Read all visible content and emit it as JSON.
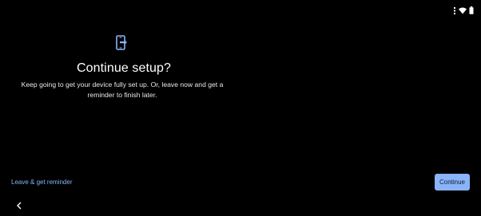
{
  "status_bar": {
    "icons": [
      "signal-icon",
      "wifi-icon",
      "battery-icon"
    ]
  },
  "setup": {
    "icon": "phone-transfer-icon",
    "title": "Continue setup?",
    "description": "Keep going to get your device fully set up. Or, leave now and get a reminder to finish later."
  },
  "actions": {
    "leave_label": "Leave & get reminder",
    "continue_label": "Continue"
  },
  "nav": {
    "back_icon": "back-icon"
  },
  "colors": {
    "background": "#000000",
    "accent": "#8ab4f8",
    "button_text": "#0b1e3a",
    "text_primary": "#ffffff"
  }
}
